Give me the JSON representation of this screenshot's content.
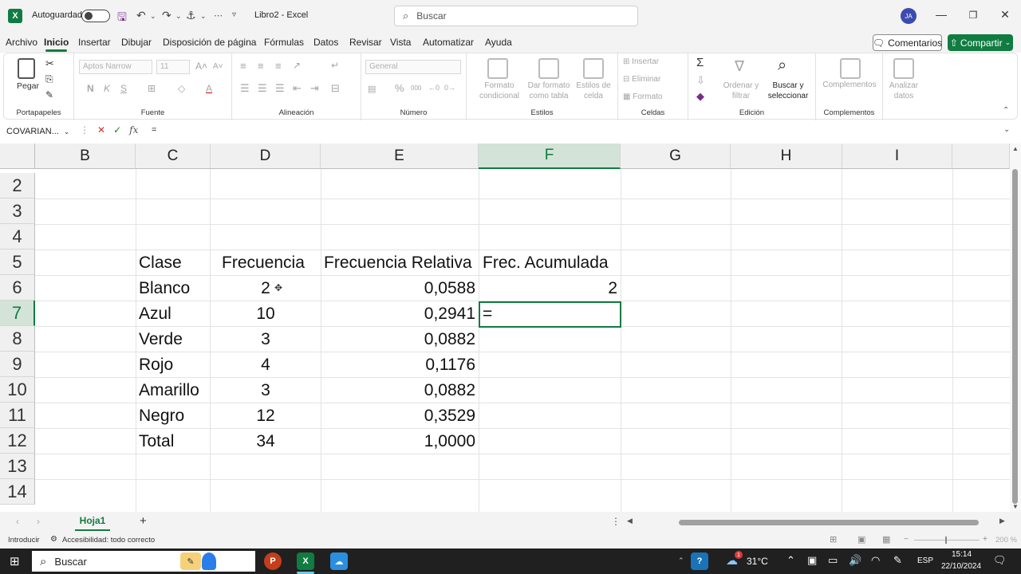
{
  "titlebar": {
    "autosave_label": "Autoguardado",
    "doc_title": "Libro2 - Excel",
    "search_placeholder": "Buscar",
    "user_initials": "JA"
  },
  "menu": {
    "items": [
      "Archivo",
      "Inicio",
      "Insertar",
      "Dibujar",
      "Disposición de página",
      "Fórmulas",
      "Datos",
      "Revisar",
      "Vista",
      "Automatizar",
      "Ayuda"
    ],
    "active": "Inicio",
    "comments_label": "Comentarios",
    "share_label": "Compartir"
  },
  "ribbon": {
    "paste_label": "Pegar",
    "font_name": "Aptos Narrow",
    "font_size": "11",
    "number_format": "General",
    "bold": "N",
    "italic": "K",
    "underline": "S",
    "conditional_format": "Formato condicional",
    "format_table": "Dar formato como tabla",
    "cell_styles": "Estilos de celda",
    "insert": "Insertar",
    "delete": "Eliminar",
    "format": "Formato",
    "sort_filter": "Ordenar y filtrar",
    "find_select": "Buscar y seleccionar",
    "addins": "Complementos",
    "analyze": "Analizar datos",
    "groups": {
      "clipboard": "Portapapeles",
      "font": "Fuente",
      "alignment": "Alineación",
      "number": "Número",
      "styles": "Estilos",
      "cells": "Celdas",
      "editing": "Edición",
      "addins": "Complementos"
    }
  },
  "formula_bar": {
    "name_box": "COVARIAN...",
    "formula": "="
  },
  "grid": {
    "columns": [
      "B",
      "C",
      "D",
      "E",
      "F",
      "G",
      "H",
      "I"
    ],
    "selected_column": "F",
    "rows": [
      "2",
      "3",
      "4",
      "5",
      "6",
      "7",
      "8",
      "9",
      "10",
      "11",
      "12",
      "13",
      "14"
    ],
    "selected_row": "7",
    "headers": {
      "clase": "Clase",
      "frecuencia": "Frecuencia",
      "frec_relativa": "Frecuencia Relativa",
      "frec_acumulada": "Frec. Acumulada"
    },
    "data": [
      {
        "clase": "Blanco",
        "frecuencia": "2",
        "relativa": "0,0588",
        "acumulada": "2"
      },
      {
        "clase": "Azul",
        "frecuencia": "10",
        "relativa": "0,2941",
        "acumulada": "="
      },
      {
        "clase": "Verde",
        "frecuencia": "3",
        "relativa": "0,0882",
        "acumulada": ""
      },
      {
        "clase": "Rojo",
        "frecuencia": "4",
        "relativa": "0,1176",
        "acumulada": ""
      },
      {
        "clase": "Amarillo",
        "frecuencia": "3",
        "relativa": "0,0882",
        "acumulada": ""
      },
      {
        "clase": "Negro",
        "frecuencia": "12",
        "relativa": "0,3529",
        "acumulada": ""
      },
      {
        "clase": "Total",
        "frecuencia": "34",
        "relativa": "1,0000",
        "acumulada": ""
      }
    ]
  },
  "sheets": {
    "tabs": [
      "Hoja1"
    ],
    "add": "+"
  },
  "status": {
    "mode": "Introducir",
    "accessibility": "Accesibilidad: todo correcto",
    "zoom": "200 %"
  },
  "taskbar": {
    "search": "Buscar",
    "temperature": "31°C",
    "lang": "ESP",
    "time": "15:14",
    "date": "22/10/2024",
    "weather_badge": "1"
  },
  "colors": {
    "accent": "#107c41",
    "selection_header": "#d3e3d7"
  }
}
